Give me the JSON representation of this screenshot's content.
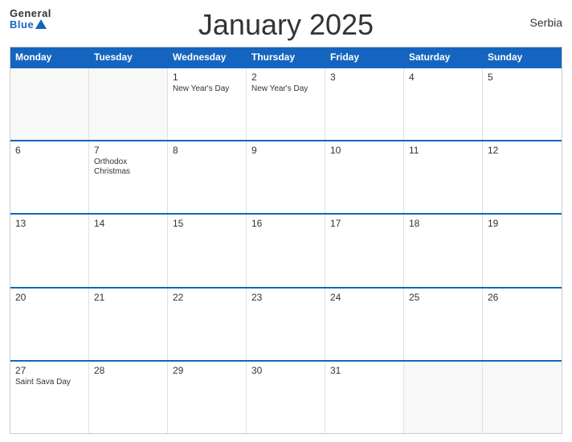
{
  "header": {
    "title": "January 2025",
    "country": "Serbia",
    "logo_general": "General",
    "logo_blue": "Blue"
  },
  "days_of_week": [
    "Monday",
    "Tuesday",
    "Wednesday",
    "Thursday",
    "Friday",
    "Saturday",
    "Sunday"
  ],
  "weeks": [
    [
      {
        "num": "",
        "holiday": ""
      },
      {
        "num": "",
        "holiday": ""
      },
      {
        "num": "1",
        "holiday": "New Year's Day"
      },
      {
        "num": "2",
        "holiday": "New Year's Day"
      },
      {
        "num": "3",
        "holiday": ""
      },
      {
        "num": "4",
        "holiday": ""
      },
      {
        "num": "5",
        "holiday": ""
      }
    ],
    [
      {
        "num": "6",
        "holiday": ""
      },
      {
        "num": "7",
        "holiday": "Orthodox Christmas"
      },
      {
        "num": "8",
        "holiday": ""
      },
      {
        "num": "9",
        "holiday": ""
      },
      {
        "num": "10",
        "holiday": ""
      },
      {
        "num": "11",
        "holiday": ""
      },
      {
        "num": "12",
        "holiday": ""
      }
    ],
    [
      {
        "num": "13",
        "holiday": ""
      },
      {
        "num": "14",
        "holiday": ""
      },
      {
        "num": "15",
        "holiday": ""
      },
      {
        "num": "16",
        "holiday": ""
      },
      {
        "num": "17",
        "holiday": ""
      },
      {
        "num": "18",
        "holiday": ""
      },
      {
        "num": "19",
        "holiday": ""
      }
    ],
    [
      {
        "num": "20",
        "holiday": ""
      },
      {
        "num": "21",
        "holiday": ""
      },
      {
        "num": "22",
        "holiday": ""
      },
      {
        "num": "23",
        "holiday": ""
      },
      {
        "num": "24",
        "holiday": ""
      },
      {
        "num": "25",
        "holiday": ""
      },
      {
        "num": "26",
        "holiday": ""
      }
    ],
    [
      {
        "num": "27",
        "holiday": "Saint Sava Day"
      },
      {
        "num": "28",
        "holiday": ""
      },
      {
        "num": "29",
        "holiday": ""
      },
      {
        "num": "30",
        "holiday": ""
      },
      {
        "num": "31",
        "holiday": ""
      },
      {
        "num": "",
        "holiday": ""
      },
      {
        "num": "",
        "holiday": ""
      }
    ]
  ]
}
